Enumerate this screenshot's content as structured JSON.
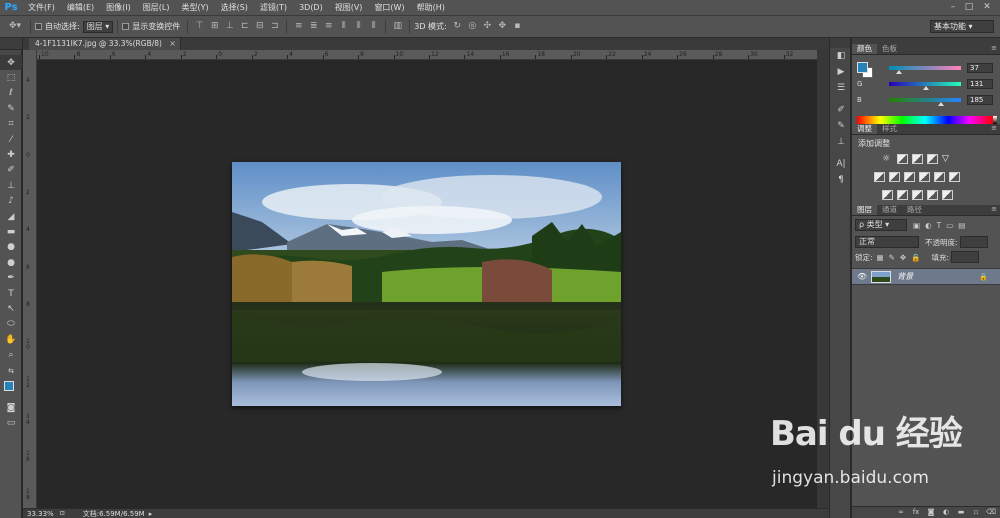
{
  "app": {
    "logo": "Ps",
    "menu": [
      "文件(F)",
      "编辑(E)",
      "图像(I)",
      "图层(L)",
      "类型(Y)",
      "选择(S)",
      "滤镜(T)",
      "3D(D)",
      "视图(V)",
      "窗口(W)",
      "帮助(H)"
    ],
    "window_controls": [
      "–",
      "□",
      "✕"
    ]
  },
  "options_bar": {
    "auto_select_label": "自动选择:",
    "auto_select_value": "图层",
    "show_transform_label": "显示变换控件",
    "mode_3d_label": "3D 模式:",
    "workspace": "基本功能"
  },
  "document": {
    "tab_title": "4-1F1131IK7.jpg @ 33.3%(RGB/8)",
    "tab_close": "×",
    "ruler_h_ticks": [
      "10",
      "8",
      "6",
      "4",
      "2",
      "0",
      "2",
      "4",
      "6",
      "8",
      "10",
      "12",
      "14",
      "16",
      "18",
      "20",
      "22",
      "24",
      "26",
      "28",
      "30",
      "32"
    ],
    "ruler_v_ticks": [
      "4",
      "2",
      "0",
      "2",
      "4",
      "6",
      "8",
      "1 0",
      "1 2",
      "1 4",
      "1 6",
      "1 8"
    ],
    "zoom": "33.33%",
    "doc_info": "文档:6.59M/6.59M"
  },
  "color_panel": {
    "tabs": [
      "颜色",
      "色板"
    ],
    "channels": [
      {
        "label": "R",
        "value": "37",
        "fraction": 0.145
      },
      {
        "label": "G",
        "value": "131",
        "fraction": 0.514
      },
      {
        "label": "B",
        "value": "185",
        "fraction": 0.725
      }
    ],
    "foreground": "#2583b9",
    "background": "#ffffff"
  },
  "adjustments_panel": {
    "tabs": [
      "调整",
      "样式"
    ],
    "title": "添加调整"
  },
  "layers_panel": {
    "tabs": [
      "图层",
      "通道",
      "路径"
    ],
    "filter_label": "ρ 类型",
    "blend_mode": "正常",
    "opacity_label": "不透明度:",
    "lock_label": "锁定:",
    "fill_label": "填充:",
    "layer_name": "背景"
  },
  "watermark": {
    "brand": "Bai du 经验",
    "url": "jingyan.baidu.com"
  }
}
